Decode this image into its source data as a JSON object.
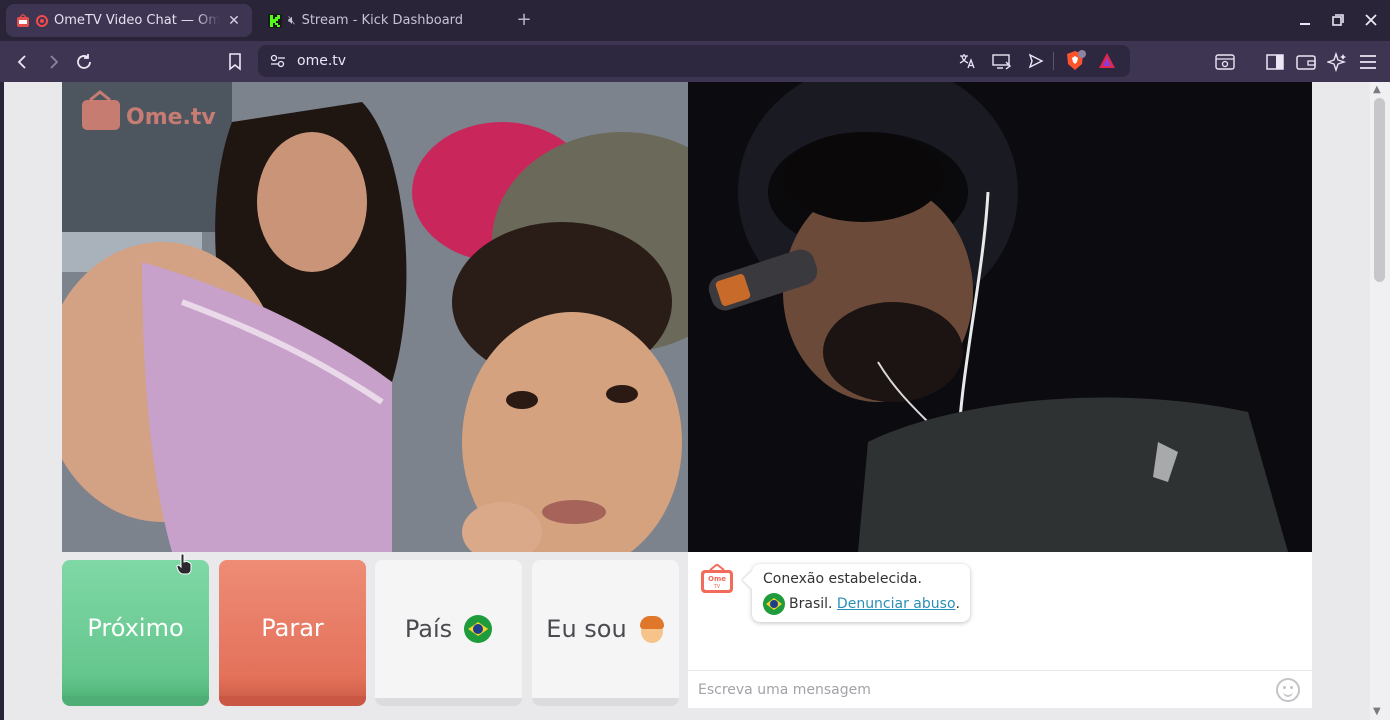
{
  "browser": {
    "tabs": [
      {
        "title": "OmeTV Video Chat — Omegle",
        "active": true
      },
      {
        "title": "Stream - Kick Dashboard",
        "active": false
      }
    ],
    "url": "ome.tv"
  },
  "page": {
    "logo_text": "Ome.tv",
    "buttons": {
      "next": "Próximo",
      "stop": "Parar",
      "country": "País",
      "gender": "Eu sou"
    },
    "chat": {
      "message_line1": "Conexão estabelecida.",
      "country_name": "Brasil.",
      "report_link": "Denunciar abuso",
      "period": ".",
      "input_placeholder": "Escreva uma mensagem"
    }
  },
  "colors": {
    "next_button": "#65c68d",
    "stop_button": "#e4725b",
    "link": "#2b8fb5",
    "browser_chrome": "#2a2438"
  }
}
